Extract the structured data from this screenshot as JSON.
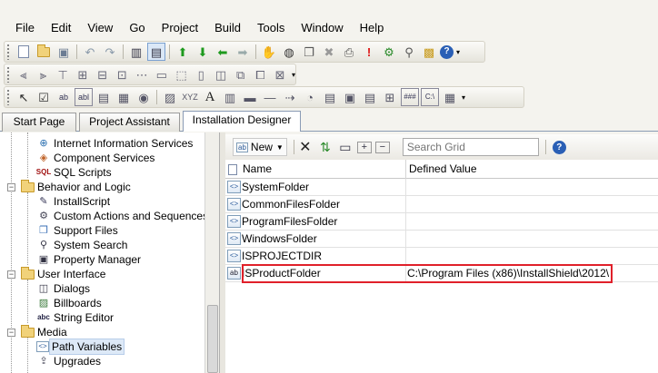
{
  "menu": [
    "File",
    "Edit",
    "View",
    "Go",
    "Project",
    "Build",
    "Tools",
    "Window",
    "Help"
  ],
  "tabs": [
    {
      "label": "Start Page",
      "active": false
    },
    {
      "label": "Project Assistant",
      "active": false
    },
    {
      "label": "Installation Designer",
      "active": true
    }
  ],
  "tree": {
    "items": [
      {
        "label": "Internet Information Services",
        "icon": "globe-icon",
        "level": 2,
        "expander": ""
      },
      {
        "label": "Component Services",
        "icon": "component-icon",
        "level": 2,
        "expander": ""
      },
      {
        "label": "SQL Scripts",
        "icon": "sql-icon",
        "level": 2,
        "expander": ""
      },
      {
        "label": "Behavior and Logic",
        "icon": "folder-icon",
        "level": 1,
        "expander": "−"
      },
      {
        "label": "InstallScript",
        "icon": "script-icon",
        "level": 2,
        "expander": ""
      },
      {
        "label": "Custom Actions and Sequences",
        "icon": "custom-actions-icon",
        "level": 2,
        "expander": ""
      },
      {
        "label": "Support Files",
        "icon": "support-files-icon",
        "level": 2,
        "expander": ""
      },
      {
        "label": "System Search",
        "icon": "search-icon",
        "level": 2,
        "expander": ""
      },
      {
        "label": "Property Manager",
        "icon": "property-icon",
        "level": 2,
        "expander": ""
      },
      {
        "label": "User Interface",
        "icon": "folder-icon",
        "level": 1,
        "expander": "−"
      },
      {
        "label": "Dialogs",
        "icon": "dialog-icon",
        "level": 2,
        "expander": ""
      },
      {
        "label": "Billboards",
        "icon": "billboard-icon",
        "level": 2,
        "expander": ""
      },
      {
        "label": "String Editor",
        "icon": "string-icon",
        "level": 2,
        "expander": ""
      },
      {
        "label": "Media",
        "icon": "folder-icon",
        "level": 1,
        "expander": "−"
      },
      {
        "label": "Path Variables",
        "icon": "path-variable-icon",
        "level": 2,
        "expander": "",
        "selected": true
      },
      {
        "label": "Upgrades",
        "icon": "upgrade-icon",
        "level": 2,
        "expander": ""
      }
    ]
  },
  "grid_toolbar": {
    "new_label": "New",
    "search_placeholder": "Search Grid"
  },
  "grid": {
    "columns": [
      "Name",
      "Defined Value"
    ],
    "rows": [
      {
        "name": "SystemFolder",
        "value": "",
        "icon": "<>"
      },
      {
        "name": "CommonFilesFolder",
        "value": "",
        "icon": "<>"
      },
      {
        "name": "ProgramFilesFolder",
        "value": "",
        "icon": "<>"
      },
      {
        "name": "WindowsFolder",
        "value": "",
        "icon": "<>"
      },
      {
        "name": "ISPROJECTDIR",
        "value": "",
        "icon": "<>"
      },
      {
        "name": "ISProductFolder",
        "value": "C:\\Program Files (x86)\\InstallShield\\2012\\",
        "icon": "ab"
      }
    ]
  },
  "colors": {
    "highlight": "#e0202a",
    "selection": "#dde9f7"
  }
}
